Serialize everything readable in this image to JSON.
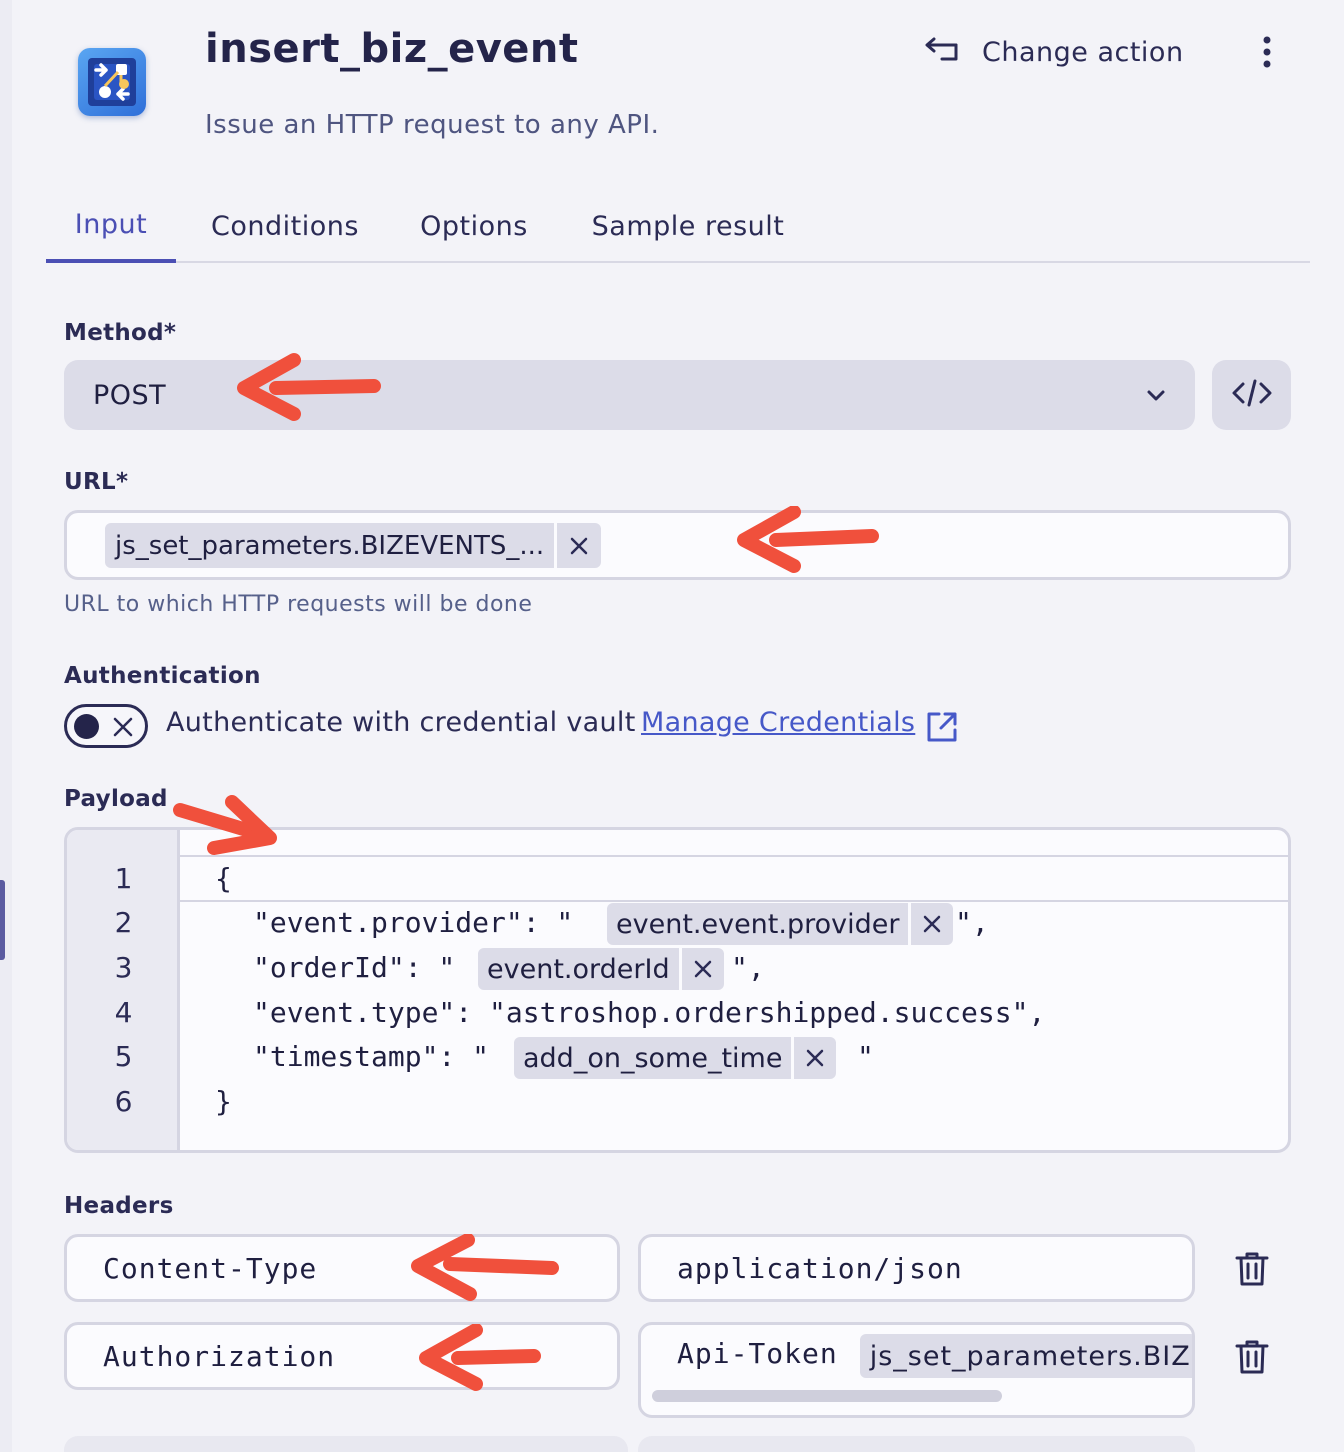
{
  "header": {
    "title": "insert_biz_event",
    "subtitle": "Issue an HTTP request to any API.",
    "change_action_label": "Change action"
  },
  "tabs": [
    {
      "label": "Input",
      "active": true
    },
    {
      "label": "Conditions",
      "active": false
    },
    {
      "label": "Options",
      "active": false
    },
    {
      "label": "Sample result",
      "active": false
    }
  ],
  "method": {
    "label": "Method*",
    "value": "POST"
  },
  "url": {
    "label": "URL*",
    "chip": "js_set_parameters.BIZEVENTS_...",
    "helper": "URL to which HTTP requests will be done"
  },
  "authentication": {
    "label": "Authentication",
    "toggle_on": false,
    "text": "Authenticate with credential vault",
    "link": "Manage Credentials"
  },
  "payload": {
    "label": "Payload",
    "line_numbers": [
      "1",
      "2",
      "3",
      "4",
      "5",
      "6"
    ],
    "lines": {
      "l1": "{",
      "l2_pre": "\"event.provider\": \"",
      "l2_chip": "event.event.provider",
      "l2_post": "\",",
      "l3_pre": "\"orderId\": \"",
      "l3_chip": "event.orderId",
      "l3_post": "\",",
      "l4": "\"event.type\": \"astroshop.ordershipped.success\",",
      "l5_pre": "\"timestamp\": \"",
      "l5_chip": "add_on_some_time",
      "l5_post": "\"",
      "l6": "}"
    }
  },
  "headers": {
    "label": "Headers",
    "rows": [
      {
        "key": "Content-Type",
        "value": "application/json"
      },
      {
        "key": "Authorization",
        "value_prefix": "Api-Token",
        "value_chip": "js_set_parameters.BIZ"
      }
    ]
  },
  "colors": {
    "accent": "#4b4fb4",
    "link": "#4658c8",
    "annotation_arrow": "#f0503c"
  }
}
